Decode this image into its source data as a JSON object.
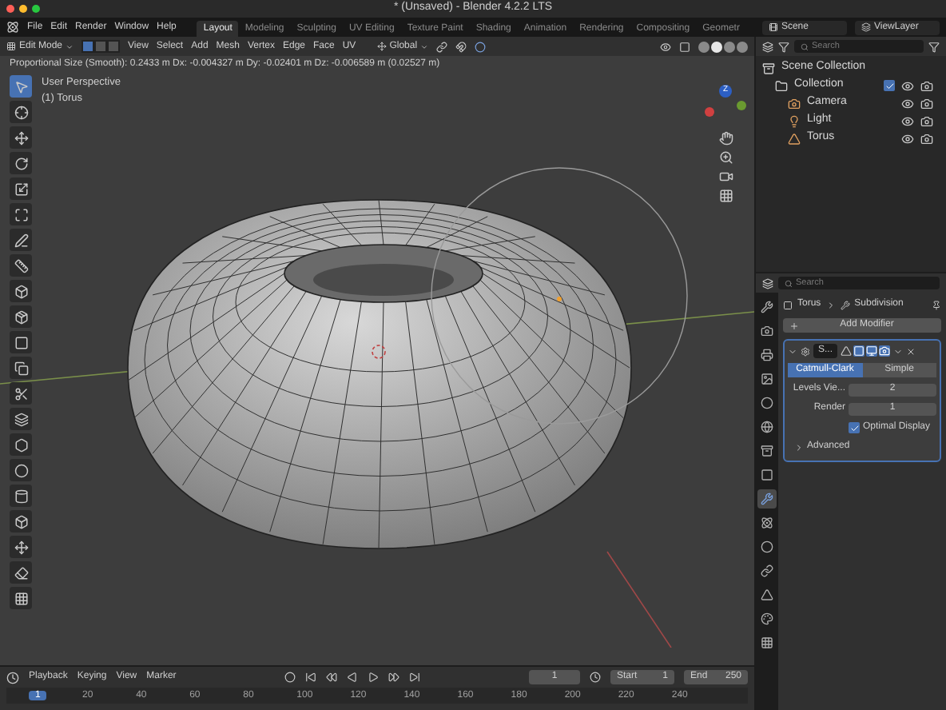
{
  "window": {
    "title": "* (Unsaved) - Blender 4.2.2 LTS"
  },
  "menu": [
    "File",
    "Edit",
    "Render",
    "Window",
    "Help"
  ],
  "workspaces": [
    {
      "label": "Layout",
      "selected": true
    },
    {
      "label": "Modeling",
      "selected": false
    },
    {
      "label": "Sculpting",
      "selected": false
    },
    {
      "label": "UV Editing",
      "selected": false
    },
    {
      "label": "Texture Paint",
      "selected": false
    },
    {
      "label": "Shading",
      "selected": false
    },
    {
      "label": "Animation",
      "selected": false
    },
    {
      "label": "Rendering",
      "selected": false
    },
    {
      "label": "Compositing",
      "selected": false
    },
    {
      "label": "Geometr",
      "selected": false
    }
  ],
  "scene": "Scene",
  "view_layer": "ViewLayer",
  "viewport_header": {
    "mode": "Edit Mode",
    "select_modes": [
      {
        "selected": true
      },
      {
        "selected": false
      },
      {
        "selected": false
      }
    ],
    "menus": [
      "View",
      "Select",
      "Add",
      "Mesh",
      "Vertex",
      "Edge",
      "Face",
      "UV"
    ],
    "orientation": "Global"
  },
  "operator_info": "Proportional Size (Smooth): 0.2433 m  Dx: -0.004327 m  Dy: -0.02401 m  Dz: -0.006589 m (0.02527 m)",
  "viewport": {
    "view_name": "User Perspective",
    "object": "(1) Torus",
    "gizmo_axis": "Z"
  },
  "outliner": {
    "search_placeholder": "Search",
    "items": [
      {
        "kind": "scene",
        "label": "Scene Collection",
        "children": [
          {
            "kind": "collection",
            "label": "Collection",
            "checked": true,
            "children": [
              {
                "kind": "camera",
                "label": "Camera"
              },
              {
                "kind": "light",
                "label": "Light"
              },
              {
                "kind": "mesh",
                "label": "Torus"
              }
            ]
          }
        ]
      }
    ]
  },
  "properties": {
    "search_placeholder": "Search",
    "tabs": [
      {
        "kind": "tool",
        "selected": false
      },
      {
        "kind": "render",
        "selected": false
      },
      {
        "kind": "output",
        "selected": false
      },
      {
        "kind": "view_layer",
        "selected": false
      },
      {
        "kind": "scene",
        "selected": false
      },
      {
        "kind": "world",
        "selected": false
      },
      {
        "kind": "collection",
        "selected": false
      },
      {
        "kind": "object",
        "selected": false
      },
      {
        "kind": "modifier",
        "selected": true
      },
      {
        "kind": "particles",
        "selected": false
      },
      {
        "kind": "physics",
        "selected": false
      },
      {
        "kind": "constraints",
        "selected": false
      },
      {
        "kind": "data",
        "selected": false
      },
      {
        "kind": "material",
        "selected": false
      },
      {
        "kind": "texture",
        "selected": false
      }
    ],
    "breadcrumb": [
      "Torus",
      "Subdivision"
    ],
    "add_modifier": "Add Modifier",
    "modifier": {
      "name": "S...",
      "expanded": true,
      "methods": [
        {
          "label": "Catmull-Clark",
          "selected": true
        },
        {
          "label": "Simple",
          "selected": false
        }
      ],
      "fields": [
        {
          "label": "Levels Vie...",
          "value": "2"
        },
        {
          "label": "Render",
          "value": "1"
        }
      ],
      "optimal_display": {
        "label": "Optimal Display",
        "checked": true
      },
      "advanced": {
        "label": "Advanced",
        "expanded": false
      }
    }
  },
  "timeline": {
    "menus": [
      "Playback",
      "Keying",
      "View",
      "Marker"
    ],
    "current_frame": "1",
    "start_label": "Start",
    "start": "1",
    "end_label": "End",
    "end": "250",
    "ruler": [
      {
        "label": "1",
        "selected": true
      },
      {
        "label": "20",
        "selected": false
      },
      {
        "label": "40",
        "selected": false
      },
      {
        "label": "60",
        "selected": false
      },
      {
        "label": "80",
        "selected": false
      },
      {
        "label": "100",
        "selected": false
      },
      {
        "label": "120",
        "selected": false
      },
      {
        "label": "140",
        "selected": false
      },
      {
        "label": "160",
        "selected": false
      },
      {
        "label": "180",
        "selected": false
      },
      {
        "label": "200",
        "selected": false
      },
      {
        "label": "220",
        "selected": false
      },
      {
        "label": "240",
        "selected": false
      }
    ]
  }
}
